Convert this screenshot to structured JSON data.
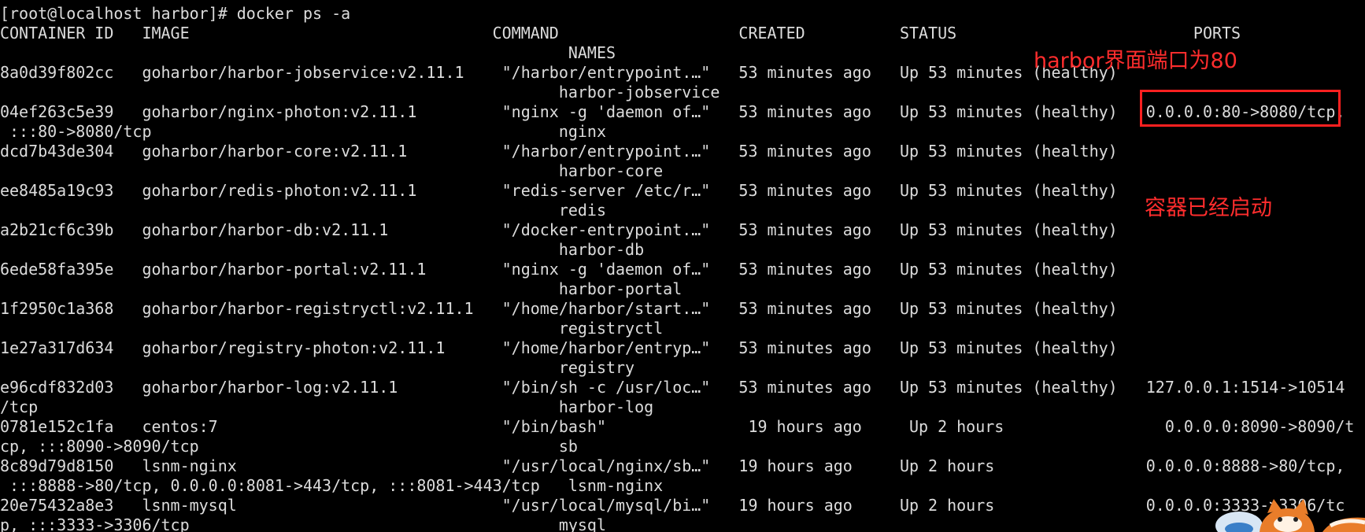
{
  "terminal": {
    "lines": [
      "[root@localhost harbor]# docker ps -a",
      "CONTAINER ID   IMAGE                                COMMAND                   CREATED          STATUS                         PORTS",
      "                                                            NAMES",
      "8a0d39f802cc   goharbor/harbor-jobservice:v2.11.1    \"/harbor/entrypoint.…\"   53 minutes ago   Up 53 minutes (healthy)",
      "                                                           harbor-jobservice",
      "04ef263c5e39   goharbor/nginx-photon:v2.11.1         \"nginx -g 'daemon of…\"   53 minutes ago   Up 53 minutes (healthy)   0.0.0.0:80->8080/tcp,",
      " :::80->8080/tcp                                           nginx",
      "dcd7b43de304   goharbor/harbor-core:v2.11.1          \"/harbor/entrypoint.…\"   53 minutes ago   Up 53 minutes (healthy)",
      "                                                           harbor-core",
      "ee8485a19c93   goharbor/redis-photon:v2.11.1         \"redis-server /etc/r…\"   53 minutes ago   Up 53 minutes (healthy)",
      "                                                           redis",
      "a2b21cf6c39b   goharbor/harbor-db:v2.11.1            \"/docker-entrypoint.…\"   53 minutes ago   Up 53 minutes (healthy)",
      "                                                           harbor-db",
      "6ede58fa395e   goharbor/harbor-portal:v2.11.1        \"nginx -g 'daemon of…\"   53 minutes ago   Up 53 minutes (healthy)",
      "                                                           harbor-portal",
      "1f2950c1a368   goharbor/harbor-registryctl:v2.11.1   \"/home/harbor/start.…\"   53 minutes ago   Up 53 minutes (healthy)",
      "                                                           registryctl",
      "1e27a317d634   goharbor/registry-photon:v2.11.1      \"/home/harbor/entryp…\"   53 minutes ago   Up 53 minutes (healthy)",
      "                                                           registry",
      "e96cdf832d03   goharbor/harbor-log:v2.11.1           \"/bin/sh -c /usr/loc…\"   53 minutes ago   Up 53 minutes (healthy)   127.0.0.1:1514->10514",
      "/tcp                                                       harbor-log",
      "0781e152c1fa   centos:7                              \"/bin/bash\"               19 hours ago     Up 2 hours                 0.0.0.0:8090->8090/t",
      "cp, :::8090->8090/tcp                                      sb",
      "8c89d79d8150   lsnm-nginx                            \"/usr/local/nginx/sb…\"   19 hours ago     Up 2 hours                0.0.0.0:8888->80/tcp,",
      " :::8888->80/tcp, 0.0.0.0:8081->443/tcp, :::8081->443/tcp   lsnm-nginx",
      "20e75432a8e3   lsnm-mysql                            \"/usr/local/mysql/bi…\"   19 hours ago     Up 2 hours                0.0.0.0:3333->3306/tc",
      "p, :::3333->3306/tcp                                       mysql"
    ]
  },
  "annotations": {
    "port_note": "harbor界面端口为80",
    "started_note": "容器已经启动"
  },
  "colors": {
    "background": "#000000",
    "text": "#dcdcdc",
    "annotation": "#ff2d2d"
  }
}
